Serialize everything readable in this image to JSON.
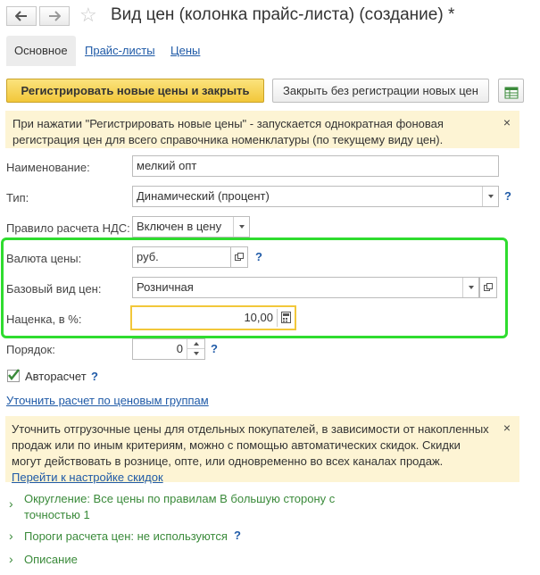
{
  "header": {
    "back_icon": "arrow-left-icon",
    "forward_icon": "arrow-right-icon",
    "favorite_icon": "star-icon",
    "title": "Вид цен (колонка прайс-листа) (создание) *"
  },
  "tabs": [
    {
      "label": "Основное",
      "active": true
    },
    {
      "label": "Прайс-листы",
      "active": false
    },
    {
      "label": "Цены",
      "active": false
    }
  ],
  "toolbar": {
    "primary_label": "Регистрировать новые цены и закрыть",
    "secondary_label": "Закрыть без регистрации новых цен",
    "report_icon": "table-report-icon"
  },
  "notice1": {
    "text": "При нажатии \"Регистрировать новые цены\" - запускается однократная фоновая регистрация цен для всего справочника номенклатуры (по текущему виду цен).",
    "close": "×"
  },
  "form": {
    "name_label": "Наименование:",
    "name_value": "мелкий опт",
    "type_label": "Тип:",
    "type_value": "Динамический (процент)",
    "vat_label": "Правило расчета НДС:",
    "vat_value": "Включен в цену",
    "currency_label": "Валюта цены:",
    "currency_value": "руб.",
    "base_label": "Базовый вид цен:",
    "base_value": "Розничная",
    "markup_label": "Наценка, в %:",
    "markup_value": "10,00",
    "order_label": "Порядок:",
    "order_value": "0",
    "autocalc_label": "Авторасчет",
    "autocalc_checked": true,
    "help": "?",
    "refine_link": "Уточнить расчет по ценовым группам"
  },
  "notice2": {
    "text": "Уточнить отгрузочные цены для отдельных покупателей, в зависимости от накопленных продаж или по иным критериям, можно с помощью автоматических скидок. Скидки могут действовать в рознице, опте, или одновременно во всех каналах продаж.",
    "link": "Перейти к настройке скидок",
    "close": "×"
  },
  "sections": [
    {
      "label": "Округление: Все цены по правилам В большую сторону с точностью 1"
    },
    {
      "label": "Пороги расчета цен: не используются"
    },
    {
      "label": "Описание"
    }
  ],
  "colors": {
    "highlight": "#2fdc2f",
    "primary": "#f2c73a",
    "link": "#1f5aa7",
    "notice_bg": "#fdf4d4",
    "section_green": "#3a8a3a"
  }
}
